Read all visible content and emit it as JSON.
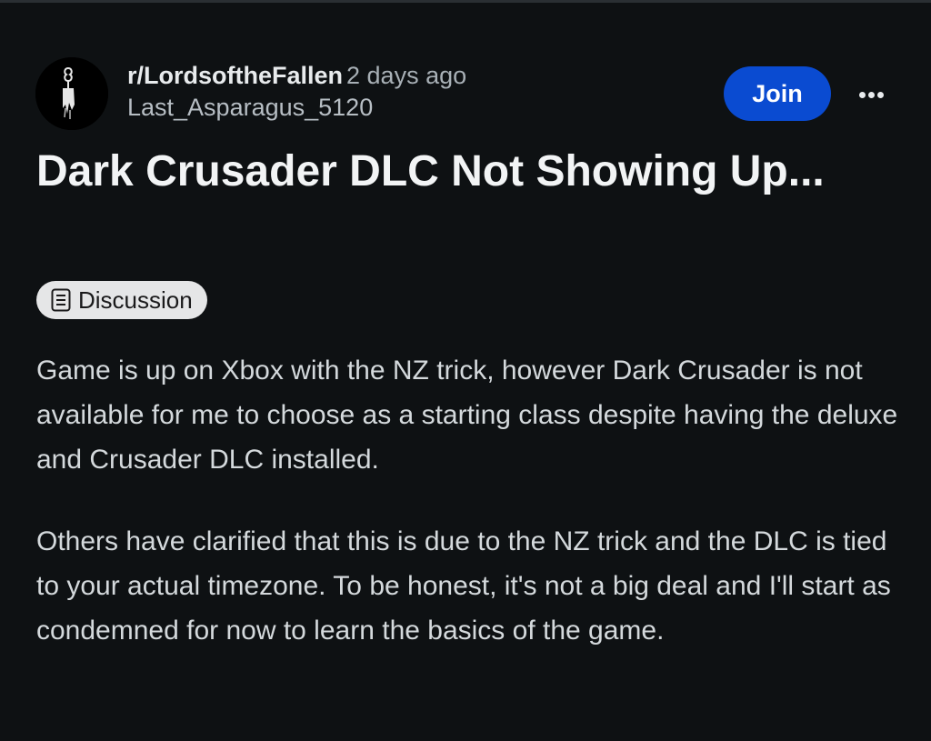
{
  "post": {
    "subreddit": "r/LordsoftheFallen",
    "time_ago": "2 days ago",
    "author": "Last_Asparagus_5120",
    "join_label": "Join",
    "more_icon": "ellipsis-icon",
    "title": "Dark Crusader DLC Not Showing Up...",
    "flair": {
      "label": "Discussion",
      "icon": "document-icon"
    },
    "body": [
      "Game is up on Xbox with the NZ trick, however Dark Crusader is not available for me to choose as a starting class despite having the deluxe and Crusader DLC installed.",
      "Others have clarified that this is due to the NZ trick and the DLC is tied to your actual timezone. To be honest, it's not a big deal and I'll start as condemned for now to learn the basics of the game."
    ]
  },
  "colors": {
    "background": "#0e1113",
    "join_button": "#0a4bd1",
    "flair_background": "#e5e6e7",
    "text": "#e8ebed",
    "muted_text": "#a8b0b6"
  }
}
